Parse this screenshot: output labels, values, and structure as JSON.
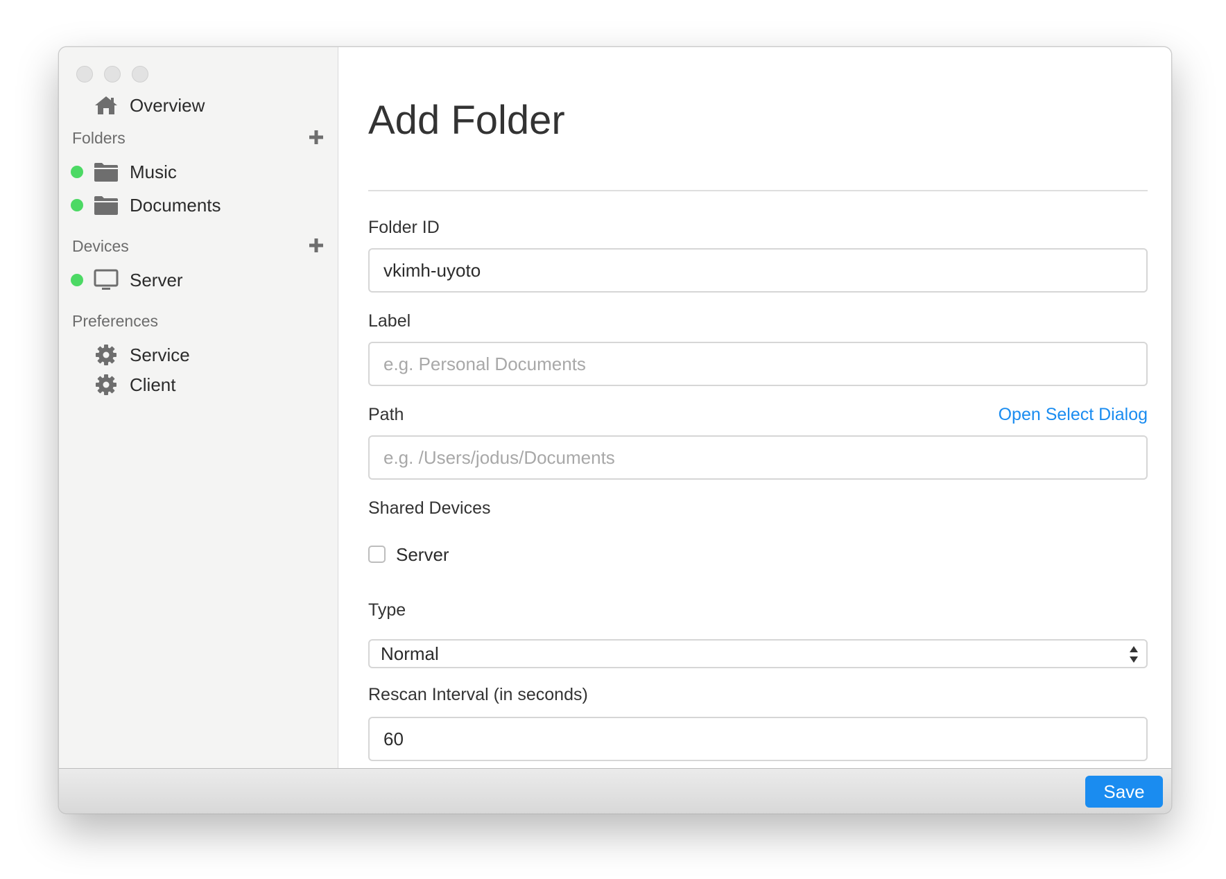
{
  "window": {
    "title": "Add Folder"
  },
  "sidebar": {
    "overview": {
      "label": "Overview",
      "icon": "home-icon"
    },
    "folders_header": "Folders",
    "folders": [
      {
        "label": "Music",
        "status": "online",
        "icon": "folder-icon"
      },
      {
        "label": "Documents",
        "status": "online",
        "icon": "folder-icon"
      }
    ],
    "devices_header": "Devices",
    "devices": [
      {
        "label": "Server",
        "status": "online",
        "icon": "monitor-icon"
      }
    ],
    "preferences_header": "Preferences",
    "preferences": [
      {
        "label": "Service",
        "icon": "gear-icon"
      },
      {
        "label": "Client",
        "icon": "gear-icon"
      }
    ]
  },
  "form": {
    "title": "Add Folder",
    "folder_id": {
      "label": "Folder ID",
      "value": "vkimh-uyoto",
      "placeholder": ""
    },
    "label": {
      "label": "Label",
      "value": "",
      "placeholder": "e.g. Personal Documents"
    },
    "path": {
      "label": "Path",
      "value": "",
      "placeholder": "e.g. /Users/jodus/Documents",
      "link": "Open Select Dialog"
    },
    "shared_devices": {
      "label": "Shared Devices",
      "options": [
        {
          "label": "Server",
          "checked": false
        }
      ]
    },
    "type": {
      "label": "Type",
      "value": "Normal"
    },
    "rescan_interval": {
      "label": "Rescan Interval (in seconds)",
      "value": "60",
      "placeholder": ""
    }
  },
  "footer": {
    "save_label": "Save"
  },
  "colors": {
    "accent": "#1a8cf0",
    "status_online": "#4cd964",
    "sidebar_bg": "#f4f4f3",
    "icon": "#6e6e6e"
  }
}
